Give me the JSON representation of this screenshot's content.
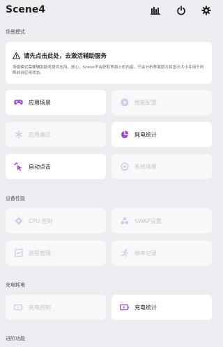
{
  "app": {
    "title": "Scene4"
  },
  "toolbar": {
    "icons": [
      "bar-chart-icon",
      "power-icon",
      "gear-icon"
    ]
  },
  "sections": {
    "scene_mode": "场景模式",
    "device_performance": "设备性能",
    "charging_power": "充电耗电",
    "advanced": "进阶功能"
  },
  "notice": {
    "title": "请先点击此处，去激活辅助服务",
    "description": "场景模式需要辅助服务提供支持。放心，Scene不会获取界面上的内容，只会分析界面层次和显示大小并用于判断前台应用状态。",
    "icon": "warning-icon"
  },
  "tiles": {
    "app_scene": {
      "label": "应用场景",
      "icon": "gamepad-icon",
      "enabled": true
    },
    "perf_config": {
      "label": "性能配置",
      "icon": "settings-circle-icon",
      "enabled": false
    },
    "app_prefs": {
      "label": "应用偏见",
      "icon": "snowflake-icon",
      "enabled": false
    },
    "power_stats": {
      "label": "耗电统计",
      "icon": "pie-chart-icon",
      "enabled": true
    },
    "auto_click": {
      "label": "自动点击",
      "icon": "tap-icon",
      "enabled": true
    },
    "system_scene": {
      "label": "系统场景",
      "icon": "target-icon",
      "enabled": false
    },
    "cpu_control": {
      "label": "CPU 控制",
      "icon": "cpu-icon",
      "enabled": false
    },
    "swap_settings": {
      "label": "SWAP设置",
      "icon": "swap-icon",
      "enabled": false
    },
    "process_manager": {
      "label": "进程管理",
      "icon": "monitor-icon",
      "enabled": false
    },
    "fps_record": {
      "label": "帧率记录",
      "icon": "running-icon",
      "enabled": false
    },
    "charge_control": {
      "label": "充电控制",
      "icon": "battery-charging-icon",
      "enabled": false
    },
    "charge_stats": {
      "label": "充电统计",
      "icon": "battery-charging-icon",
      "enabled": true
    }
  },
  "colors": {
    "accent": "#9b4ddb",
    "disabled": "#d7c8ea",
    "background": "#ececf1"
  }
}
